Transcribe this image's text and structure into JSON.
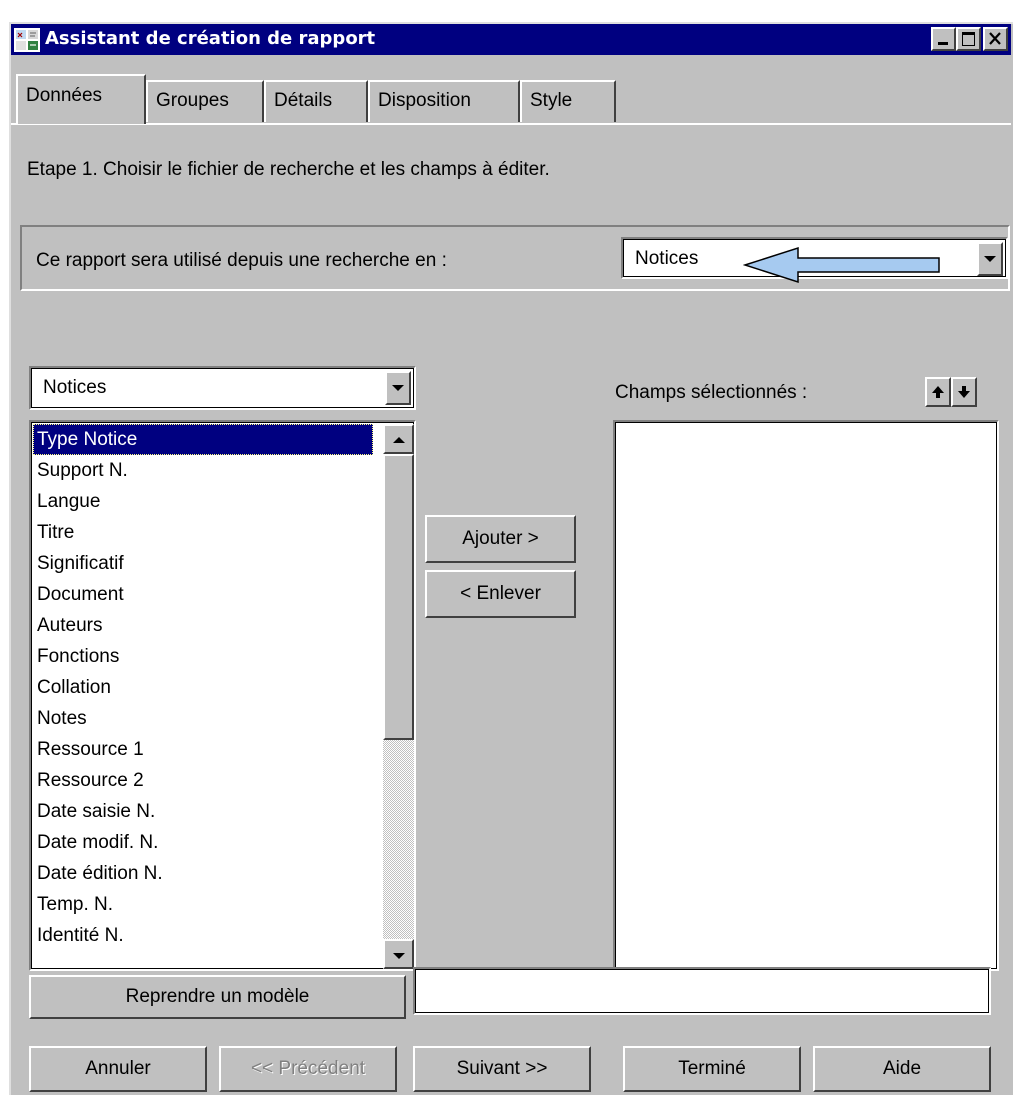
{
  "window": {
    "title": "Assistant de création de rapport"
  },
  "tabs": [
    {
      "label": "Données",
      "active": true
    },
    {
      "label": "Groupes",
      "active": false
    },
    {
      "label": "Détails",
      "active": false
    },
    {
      "label": "Disposition",
      "active": false
    },
    {
      "label": "Style",
      "active": false
    }
  ],
  "step_text": "Etape 1. Choisir le fichier de recherche et les champs à éditer.",
  "search_scope": {
    "label": "Ce rapport sera utilisé depuis une recherche en :",
    "value": "Notices"
  },
  "source_select": {
    "value": "Notices"
  },
  "selected_fields": {
    "label": "Champs sélectionnés :",
    "items": []
  },
  "available_fields": {
    "selected_index": 0,
    "items": [
      "Type Notice",
      "Support N.",
      "Langue",
      "Titre",
      "Significatif",
      "Document",
      "Auteurs",
      "Fonctions",
      "Collation",
      "Notes",
      "Ressource 1",
      "Ressource 2",
      "Date saisie N.",
      "Date modif. N.",
      "Date édition N.",
      "Temp. N.",
      "Identité N."
    ]
  },
  "buttons": {
    "add": "Ajouter >",
    "remove": "< Enlever",
    "template": "Reprendre un modèle",
    "cancel": "Annuler",
    "previous": "<< Précédent",
    "next": "Suivant >>",
    "finish": "Terminé",
    "help": "Aide"
  },
  "template_field": {
    "value": ""
  },
  "colors": {
    "title_bar": "#000080",
    "face": "#c0c0c0",
    "selection": "#000080",
    "annotation_arrow": "#a6caf0"
  }
}
